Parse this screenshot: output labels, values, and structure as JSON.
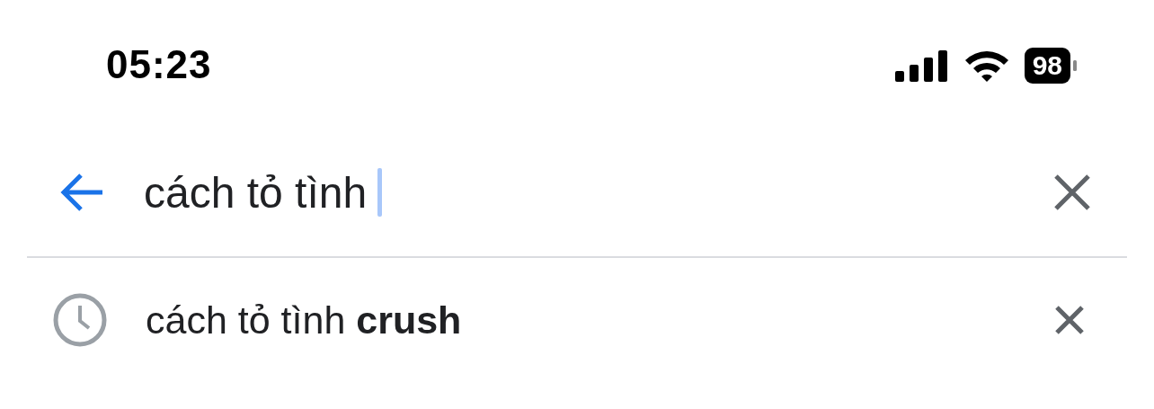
{
  "status_bar": {
    "time": "05:23",
    "battery": "98"
  },
  "search": {
    "value": "cách tỏ tình",
    "focused": true
  },
  "suggestions": [
    {
      "text": "cách tỏ tình **crush**",
      "kind": "history"
    }
  ]
}
